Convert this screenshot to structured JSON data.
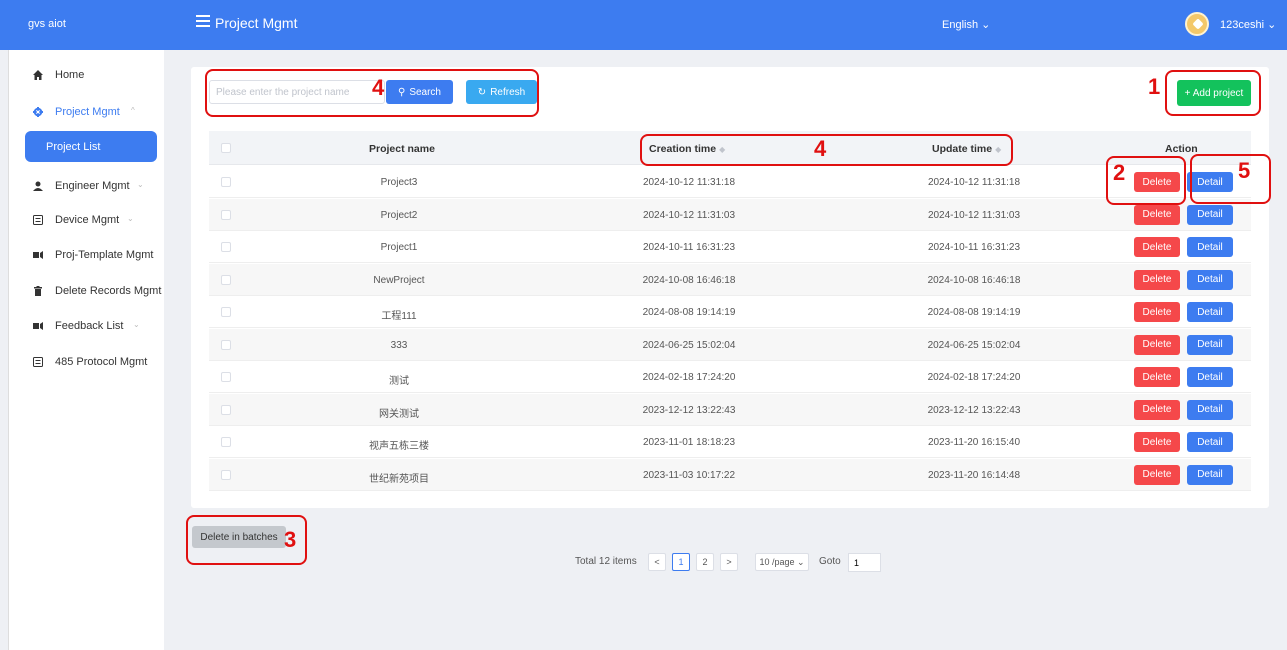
{
  "app": {
    "brand": "gvs aiot",
    "title": "Project Mgmt"
  },
  "header": {
    "language": "English ⌄",
    "user": "123ceshi ⌄"
  },
  "sidebar": {
    "items": [
      {
        "label": "Home",
        "icon": "home-icon"
      },
      {
        "label": "Project Mgmt",
        "icon": "gear-icon",
        "chevron": "^"
      },
      {
        "label": "Engineer Mgmt",
        "icon": "user-icon",
        "chevron": "⌄"
      },
      {
        "label": "Device Mgmt",
        "icon": "device-icon",
        "chevron": "⌄"
      },
      {
        "label": "Proj-Template Mgmt",
        "icon": "template-icon"
      },
      {
        "label": "Delete Records Mgmt",
        "icon": "trash-icon"
      },
      {
        "label": "Feedback List",
        "icon": "feedback-icon",
        "chevron": "⌄"
      },
      {
        "label": "485 Protocol Mgmt",
        "icon": "protocol-icon"
      }
    ],
    "sub_active": "Project List"
  },
  "toolbar": {
    "search_placeholder": "Please enter the project name",
    "search_label": "Search",
    "refresh_label": "Refresh",
    "add_label": "+ Add project"
  },
  "table": {
    "headers": {
      "name": "Project name",
      "created": "Creation time",
      "updated": "Update time",
      "action": "Action"
    },
    "delete_label": "Delete",
    "detail_label": "Detail",
    "rows": [
      {
        "name": "Project3",
        "created": "2024-10-12 11:31:18",
        "updated": "2024-10-12 11:31:18"
      },
      {
        "name": "Project2",
        "created": "2024-10-12 11:31:03",
        "updated": "2024-10-12 11:31:03"
      },
      {
        "name": "Project1",
        "created": "2024-10-11 16:31:23",
        "updated": "2024-10-11 16:31:23"
      },
      {
        "name": "NewProject",
        "created": "2024-10-08 16:46:18",
        "updated": "2024-10-08 16:46:18"
      },
      {
        "name": "工程111",
        "created": "2024-08-08 19:14:19",
        "updated": "2024-08-08 19:14:19"
      },
      {
        "name": "333",
        "created": "2024-06-25 15:02:04",
        "updated": "2024-06-25 15:02:04"
      },
      {
        "name": "测试",
        "created": "2024-02-18 17:24:20",
        "updated": "2024-02-18 17:24:20"
      },
      {
        "name": "网关测试",
        "created": "2023-12-12 13:22:43",
        "updated": "2023-12-12 13:22:43"
      },
      {
        "name": "视声五栋三楼",
        "created": "2023-11-01 18:18:23",
        "updated": "2023-11-20 16:15:40"
      },
      {
        "name": "世纪新苑项目",
        "created": "2023-11-03 10:17:22",
        "updated": "2023-11-20 16:14:48"
      }
    ]
  },
  "batch_delete_label": "Delete in batches",
  "pagination": {
    "total": "Total 12 items",
    "prev": "<",
    "pages": [
      "1",
      "2"
    ],
    "next": ">",
    "page_size": "10 /page ⌄",
    "goto_label": "Goto",
    "goto_value": "1"
  },
  "annotations": [
    "1",
    "2",
    "3",
    "4",
    "4",
    "5"
  ],
  "colors": {
    "primary": "#3d7cf0",
    "danger": "#f5484a",
    "success": "#13c25c",
    "annotation": "#e01010"
  }
}
